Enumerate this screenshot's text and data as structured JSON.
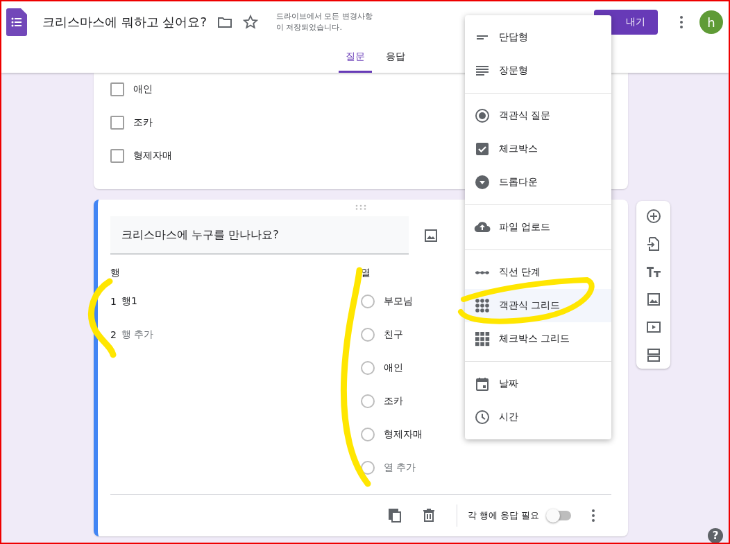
{
  "header": {
    "title": "크리스마스에 뭐하고 싶어요?",
    "save_status": [
      "드라이브에서 모든 변경사항",
      "이 저장되었습니다."
    ],
    "send_button": "내기",
    "avatar": "h"
  },
  "tabs": [
    {
      "label": "질문",
      "selected": true
    },
    {
      "label": "응답",
      "selected": false
    }
  ],
  "previous_question": {
    "options": [
      {
        "label": "애인",
        "checked": false
      },
      {
        "label": "조카",
        "checked": false
      },
      {
        "label": "형제자매",
        "checked": false
      }
    ]
  },
  "question": {
    "title": "크리스마스에 누구를 만나나요?",
    "rows_label": "행",
    "rows": [
      {
        "number": "1",
        "label": "행1",
        "kind": "item"
      },
      {
        "number": "2",
        "label": "행 추가",
        "kind": "add"
      }
    ],
    "columns_label": "열",
    "columns": [
      {
        "label": "부모님",
        "kind": "item"
      },
      {
        "label": "친구",
        "kind": "item"
      },
      {
        "label": "애인",
        "kind": "item"
      },
      {
        "label": "조카",
        "kind": "item"
      },
      {
        "label": "형제자매",
        "kind": "item"
      },
      {
        "label": "열 추가",
        "kind": "add"
      }
    ],
    "required_label": "각 행에 응답 필요",
    "required": false
  },
  "type_menu": {
    "groups": [
      {
        "items": [
          {
            "label": "단답형",
            "kind": "short",
            "selected": false
          },
          {
            "label": "장문형",
            "kind": "paragraph",
            "selected": false
          }
        ]
      },
      {
        "items": [
          {
            "label": "객관식 질문",
            "kind": "radio",
            "selected": false
          },
          {
            "label": "체크박스",
            "kind": "checkbox",
            "selected": false
          },
          {
            "label": "드롭다운",
            "kind": "dropdown",
            "selected": false
          }
        ]
      },
      {
        "items": [
          {
            "label": "파일 업로드",
            "kind": "upload",
            "selected": false
          }
        ]
      },
      {
        "items": [
          {
            "label": "직선 단계",
            "kind": "linear",
            "selected": false
          },
          {
            "label": "객관식 그리드",
            "kind": "radio_grid",
            "selected": true
          },
          {
            "label": "체크박스 그리드",
            "kind": "checkbox_grid",
            "selected": false
          }
        ]
      },
      {
        "items": [
          {
            "label": "날짜",
            "kind": "date",
            "selected": false
          },
          {
            "label": "시간",
            "kind": "time",
            "selected": false
          }
        ]
      }
    ]
  },
  "help": "?"
}
